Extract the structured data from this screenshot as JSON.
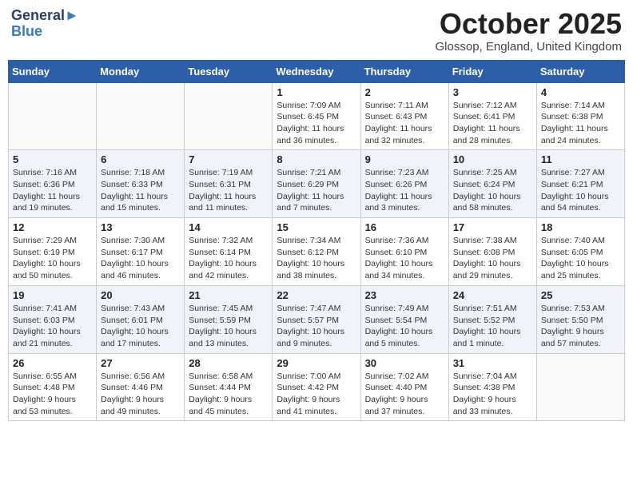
{
  "header": {
    "logo_line1": "General",
    "logo_line2": "Blue",
    "month": "October 2025",
    "location": "Glossop, England, United Kingdom"
  },
  "days_of_week": [
    "Sunday",
    "Monday",
    "Tuesday",
    "Wednesday",
    "Thursday",
    "Friday",
    "Saturday"
  ],
  "weeks": [
    [
      {
        "day": "",
        "info": ""
      },
      {
        "day": "",
        "info": ""
      },
      {
        "day": "",
        "info": ""
      },
      {
        "day": "1",
        "info": "Sunrise: 7:09 AM\nSunset: 6:45 PM\nDaylight: 11 hours\nand 36 minutes."
      },
      {
        "day": "2",
        "info": "Sunrise: 7:11 AM\nSunset: 6:43 PM\nDaylight: 11 hours\nand 32 minutes."
      },
      {
        "day": "3",
        "info": "Sunrise: 7:12 AM\nSunset: 6:41 PM\nDaylight: 11 hours\nand 28 minutes."
      },
      {
        "day": "4",
        "info": "Sunrise: 7:14 AM\nSunset: 6:38 PM\nDaylight: 11 hours\nand 24 minutes."
      }
    ],
    [
      {
        "day": "5",
        "info": "Sunrise: 7:16 AM\nSunset: 6:36 PM\nDaylight: 11 hours\nand 19 minutes."
      },
      {
        "day": "6",
        "info": "Sunrise: 7:18 AM\nSunset: 6:33 PM\nDaylight: 11 hours\nand 15 minutes."
      },
      {
        "day": "7",
        "info": "Sunrise: 7:19 AM\nSunset: 6:31 PM\nDaylight: 11 hours\nand 11 minutes."
      },
      {
        "day": "8",
        "info": "Sunrise: 7:21 AM\nSunset: 6:29 PM\nDaylight: 11 hours\nand 7 minutes."
      },
      {
        "day": "9",
        "info": "Sunrise: 7:23 AM\nSunset: 6:26 PM\nDaylight: 11 hours\nand 3 minutes."
      },
      {
        "day": "10",
        "info": "Sunrise: 7:25 AM\nSunset: 6:24 PM\nDaylight: 10 hours\nand 58 minutes."
      },
      {
        "day": "11",
        "info": "Sunrise: 7:27 AM\nSunset: 6:21 PM\nDaylight: 10 hours\nand 54 minutes."
      }
    ],
    [
      {
        "day": "12",
        "info": "Sunrise: 7:29 AM\nSunset: 6:19 PM\nDaylight: 10 hours\nand 50 minutes."
      },
      {
        "day": "13",
        "info": "Sunrise: 7:30 AM\nSunset: 6:17 PM\nDaylight: 10 hours\nand 46 minutes."
      },
      {
        "day": "14",
        "info": "Sunrise: 7:32 AM\nSunset: 6:14 PM\nDaylight: 10 hours\nand 42 minutes."
      },
      {
        "day": "15",
        "info": "Sunrise: 7:34 AM\nSunset: 6:12 PM\nDaylight: 10 hours\nand 38 minutes."
      },
      {
        "day": "16",
        "info": "Sunrise: 7:36 AM\nSunset: 6:10 PM\nDaylight: 10 hours\nand 34 minutes."
      },
      {
        "day": "17",
        "info": "Sunrise: 7:38 AM\nSunset: 6:08 PM\nDaylight: 10 hours\nand 29 minutes."
      },
      {
        "day": "18",
        "info": "Sunrise: 7:40 AM\nSunset: 6:05 PM\nDaylight: 10 hours\nand 25 minutes."
      }
    ],
    [
      {
        "day": "19",
        "info": "Sunrise: 7:41 AM\nSunset: 6:03 PM\nDaylight: 10 hours\nand 21 minutes."
      },
      {
        "day": "20",
        "info": "Sunrise: 7:43 AM\nSunset: 6:01 PM\nDaylight: 10 hours\nand 17 minutes."
      },
      {
        "day": "21",
        "info": "Sunrise: 7:45 AM\nSunset: 5:59 PM\nDaylight: 10 hours\nand 13 minutes."
      },
      {
        "day": "22",
        "info": "Sunrise: 7:47 AM\nSunset: 5:57 PM\nDaylight: 10 hours\nand 9 minutes."
      },
      {
        "day": "23",
        "info": "Sunrise: 7:49 AM\nSunset: 5:54 PM\nDaylight: 10 hours\nand 5 minutes."
      },
      {
        "day": "24",
        "info": "Sunrise: 7:51 AM\nSunset: 5:52 PM\nDaylight: 10 hours\nand 1 minute."
      },
      {
        "day": "25",
        "info": "Sunrise: 7:53 AM\nSunset: 5:50 PM\nDaylight: 9 hours\nand 57 minutes."
      }
    ],
    [
      {
        "day": "26",
        "info": "Sunrise: 6:55 AM\nSunset: 4:48 PM\nDaylight: 9 hours\nand 53 minutes."
      },
      {
        "day": "27",
        "info": "Sunrise: 6:56 AM\nSunset: 4:46 PM\nDaylight: 9 hours\nand 49 minutes."
      },
      {
        "day": "28",
        "info": "Sunrise: 6:58 AM\nSunset: 4:44 PM\nDaylight: 9 hours\nand 45 minutes."
      },
      {
        "day": "29",
        "info": "Sunrise: 7:00 AM\nSunset: 4:42 PM\nDaylight: 9 hours\nand 41 minutes."
      },
      {
        "day": "30",
        "info": "Sunrise: 7:02 AM\nSunset: 4:40 PM\nDaylight: 9 hours\nand 37 minutes."
      },
      {
        "day": "31",
        "info": "Sunrise: 7:04 AM\nSunset: 4:38 PM\nDaylight: 9 hours\nand 33 minutes."
      },
      {
        "day": "",
        "info": ""
      }
    ]
  ]
}
